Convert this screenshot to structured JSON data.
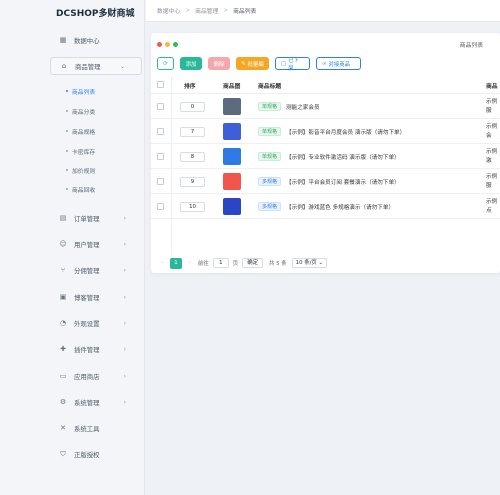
{
  "brand": "DCSHOP多财商城",
  "breadcrumb": [
    "数据中心",
    "商品管理",
    "商品列表"
  ],
  "sidebar": {
    "items": [
      {
        "label": "数据中心",
        "icon": "dashboard-icon"
      },
      {
        "label": "商品管理",
        "icon": "bag-icon"
      },
      {
        "label": "订单管理",
        "icon": "order-icon"
      },
      {
        "label": "用户管理",
        "icon": "user-icon"
      },
      {
        "label": "分佣管理",
        "icon": "branch-icon"
      },
      {
        "label": "博客管理",
        "icon": "blog-icon"
      },
      {
        "label": "外观设置",
        "icon": "palette-icon"
      },
      {
        "label": "插件管理",
        "icon": "plugin-icon"
      },
      {
        "label": "应用商店",
        "icon": "store-icon"
      },
      {
        "label": "系统管理",
        "icon": "gear-icon"
      },
      {
        "label": "系统工具",
        "icon": "tools-icon"
      },
      {
        "label": "正版授权",
        "icon": "shield-icon"
      }
    ],
    "sub_items": [
      "商品列表",
      "商品分类",
      "商品规格",
      "卡密库存",
      "加价规则",
      "商品回收"
    ]
  },
  "panel_title": "商品列表",
  "toolbar": {
    "add": "添加",
    "delete": "删除",
    "batch_edit": "批量编",
    "off_shelf": "已下架",
    "bulk_products": "对接商品"
  },
  "columns": {
    "sort": "排序",
    "image": "商品图",
    "title": "商品标题",
    "sample": "商品"
  },
  "rows": [
    {
      "sort": "0",
      "tag": "单规格",
      "title": "测能之家会员",
      "sample": [
        "示例",
        "服"
      ],
      "thumb": "#5d6b7e"
    },
    {
      "sort": "7",
      "tag": "单规格",
      "title": "【示例】影音平台月度会员 演示版（请勿下单）",
      "sample": [
        "示例",
        "会"
      ],
      "thumb": "#3f5fd8"
    },
    {
      "sort": "8",
      "tag": "单规格",
      "title": "【示例】专业软件激活码 演示版（请勿下单）",
      "sample": [
        "示例",
        "激"
      ],
      "thumb": "#2f7ae5"
    },
    {
      "sort": "9",
      "tag": "多规格",
      "title": "【示例】平台会员订阅 套餐演示（请勿下单）",
      "sample": [
        "示例",
        "服"
      ],
      "thumb": "#f0564d"
    },
    {
      "sort": "10",
      "tag": "多规格",
      "title": "【示例】游戏蓝色 多规格演示（请勿下单）",
      "sample": [
        "示例",
        "点"
      ],
      "thumb": "#2a46c4"
    }
  ],
  "pagination": {
    "current": "1",
    "goto_label": "前往",
    "goto_value": "1",
    "page_unit": "页",
    "confirm": "确定",
    "total": "共 5 条",
    "per_page": "10 条/页"
  },
  "colors": {
    "accent": "#2bb89a",
    "danger": "#f5a7ae",
    "warning": "#f5a623",
    "primary": "#2f80ed"
  }
}
